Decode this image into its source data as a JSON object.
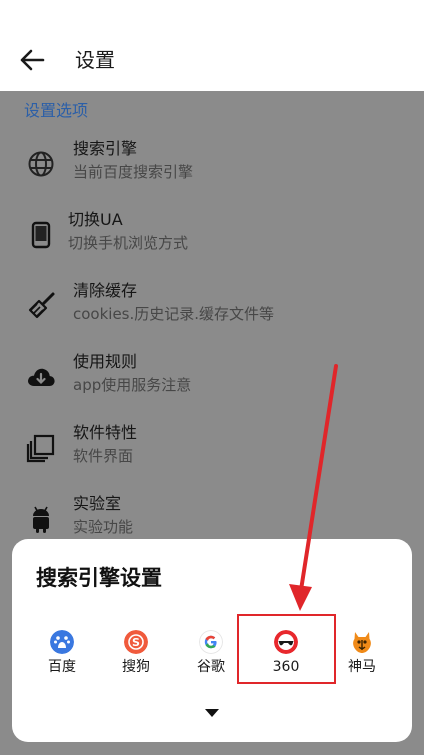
{
  "appbar": {
    "title": "设置"
  },
  "settings": {
    "section_header": "设置选项",
    "items": [
      {
        "key": "search",
        "title": "搜索引擎",
        "subtitle": "当前百度搜索引擎",
        "icon": "globe-icon"
      },
      {
        "key": "ua",
        "title": "切换UA",
        "subtitle": "切换手机浏览方式",
        "icon": "phone-icon"
      },
      {
        "key": "cache",
        "title": "清除缓存",
        "subtitle": "cookies.历史记录.缓存文件等",
        "icon": "broom-icon"
      },
      {
        "key": "rules",
        "title": "使用规则",
        "subtitle": "app使用服务注意",
        "icon": "cloud-download-icon"
      },
      {
        "key": "features",
        "title": "软件特性",
        "subtitle": "软件界面",
        "icon": "layers-icon"
      },
      {
        "key": "lab",
        "title": "实验室",
        "subtitle": "实验功能",
        "icon": "android-icon"
      }
    ]
  },
  "sheet": {
    "title": "搜索引擎设置",
    "engines": [
      {
        "name": "百度",
        "color": "#3a78e0",
        "icon": "baidu-icon"
      },
      {
        "name": "搜狗",
        "color": "#f05a3c",
        "icon": "sogou-icon"
      },
      {
        "name": "谷歌",
        "color": "#ffffff",
        "icon": "google-icon"
      },
      {
        "name": "360",
        "color": "#e8282d",
        "icon": "360-icon"
      },
      {
        "name": "神马",
        "color": "#f08a18",
        "icon": "shenma-icon"
      }
    ]
  },
  "annotation": {
    "color": "#e0262a"
  }
}
